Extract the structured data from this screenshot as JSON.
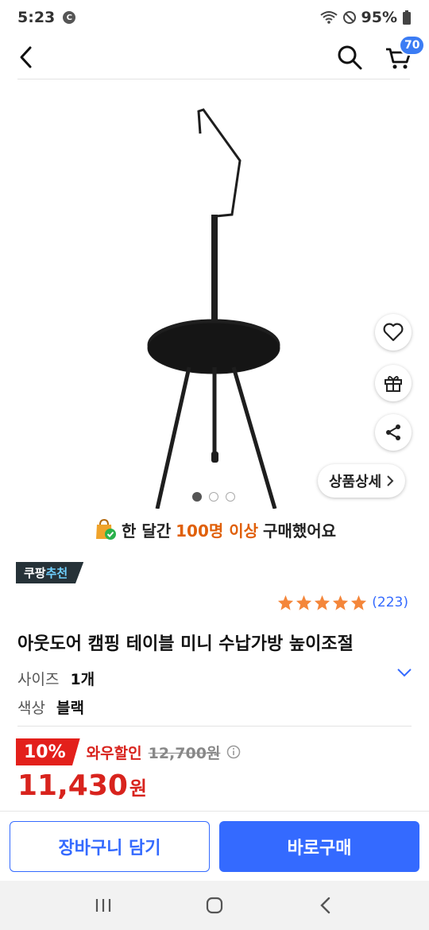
{
  "status": {
    "time": "5:23",
    "notif_badge": "C",
    "battery": "95%"
  },
  "header": {
    "cart_count": "70"
  },
  "gallery": {
    "detail_label": "상품상세",
    "dot_count": 3,
    "active_index": 0
  },
  "purchase": {
    "prefix": "한 달간",
    "highlight": "100명 이상",
    "suffix": "구매했어요"
  },
  "badge": {
    "brand": "쿠팡",
    "accent": "추천"
  },
  "rating": {
    "stars": 5,
    "count": "(223)"
  },
  "product": {
    "title": "아웃도어 캠핑 테이블 미니 수납가방 높이조절"
  },
  "options": [
    {
      "key": "사이즈",
      "value": "1개"
    },
    {
      "key": "색상",
      "value": "블랙"
    }
  ],
  "pricing": {
    "discount": "10%",
    "wow_label": "와우할인",
    "original_price": "12,700원",
    "price": "11,430",
    "unit": "원"
  },
  "actions": {
    "add_to_cart": "장바구니 담기",
    "buy_now": "바로구매"
  },
  "colors": {
    "accent_blue": "#346aff",
    "sale_red": "#d8231d",
    "star_orange": "#f4863a"
  }
}
